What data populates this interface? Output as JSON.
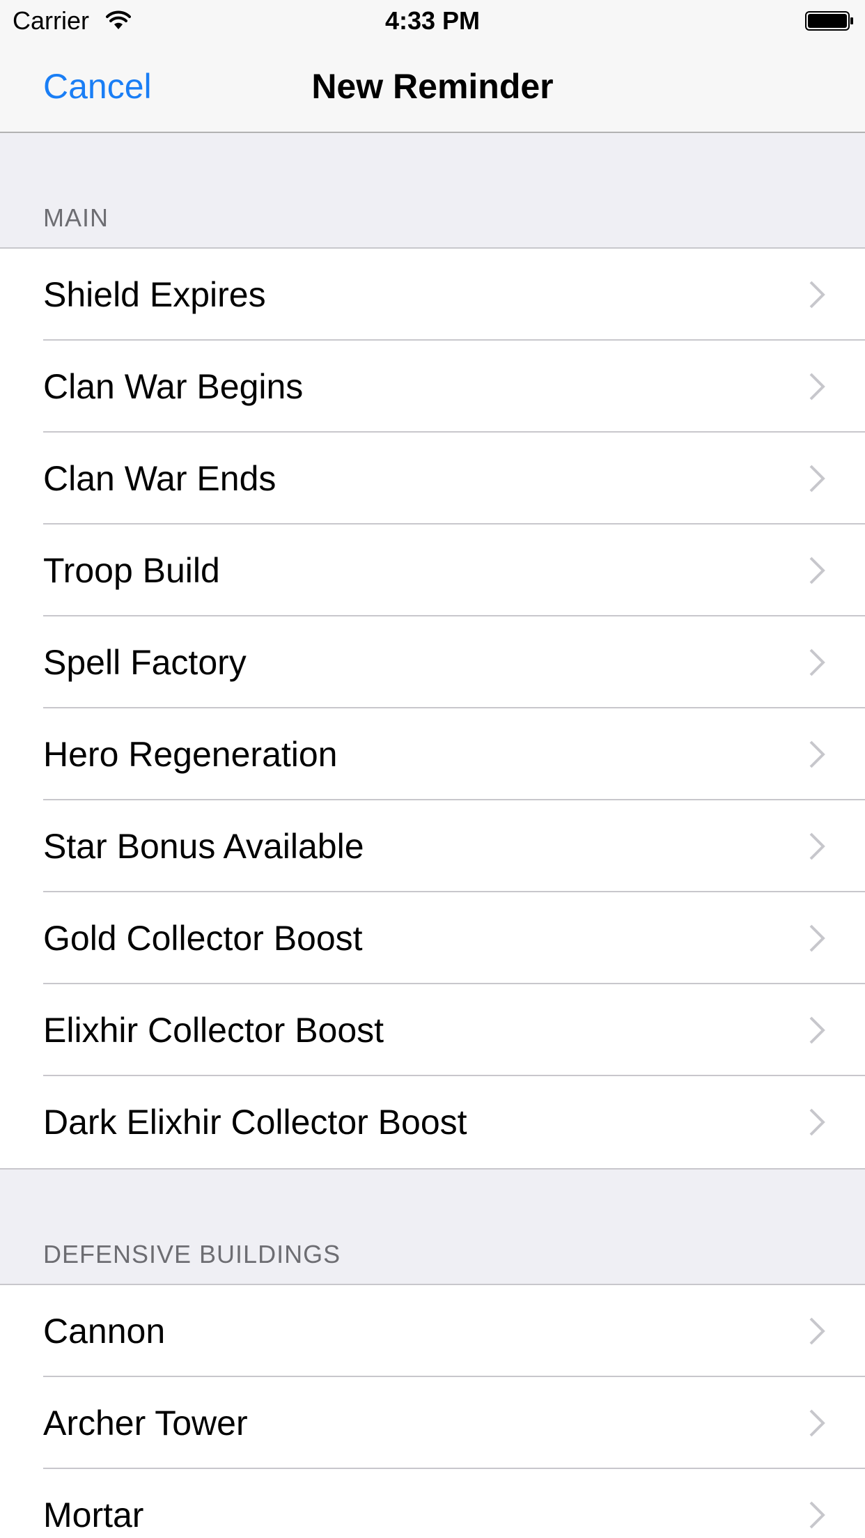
{
  "status_bar": {
    "carrier": "Carrier",
    "time": "4:33 PM",
    "wifi_icon": "wifi-icon",
    "battery_icon": "battery-icon"
  },
  "nav": {
    "cancel_label": "Cancel",
    "title": "New Reminder"
  },
  "colors": {
    "accent": "#1a7ef5",
    "background": "#efeff4",
    "separator": "#c8c7cc",
    "header_text": "#6d6d72",
    "chevron": "#c7c7cc"
  },
  "sections": [
    {
      "header": "MAIN",
      "items": [
        {
          "label": "Shield Expires"
        },
        {
          "label": "Clan War Begins"
        },
        {
          "label": "Clan War Ends"
        },
        {
          "label": "Troop Build"
        },
        {
          "label": "Spell Factory"
        },
        {
          "label": "Hero Regeneration"
        },
        {
          "label": "Star Bonus Available"
        },
        {
          "label": "Gold Collector Boost"
        },
        {
          "label": "Elixhir Collector Boost"
        },
        {
          "label": "Dark Elixhir Collector Boost"
        }
      ]
    },
    {
      "header": "DEFENSIVE BUILDINGS",
      "items": [
        {
          "label": "Cannon"
        },
        {
          "label": "Archer Tower"
        },
        {
          "label": "Mortar"
        }
      ]
    }
  ]
}
